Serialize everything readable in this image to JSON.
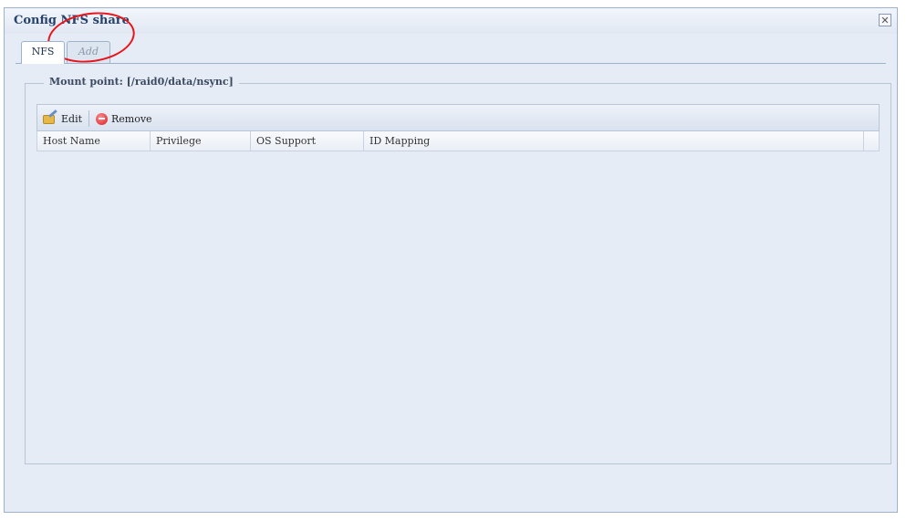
{
  "window": {
    "title": "Config NFS share",
    "close_label": "✕"
  },
  "tabs": [
    {
      "label": "NFS"
    },
    {
      "label": "Add"
    }
  ],
  "mount_point": {
    "legend": "Mount point: [/raid0/data/nsync]"
  },
  "toolbar": {
    "edit_label": "Edit",
    "remove_label": "Remove",
    "edit_icon": "edit-icon",
    "remove_icon": "remove-icon"
  },
  "grid": {
    "columns": [
      "Host Name",
      "Privilege",
      "OS Support",
      "ID Mapping"
    ],
    "rows": []
  },
  "colors": {
    "annotation": "#e8141b",
    "window_bg": "#e6ecf6"
  }
}
